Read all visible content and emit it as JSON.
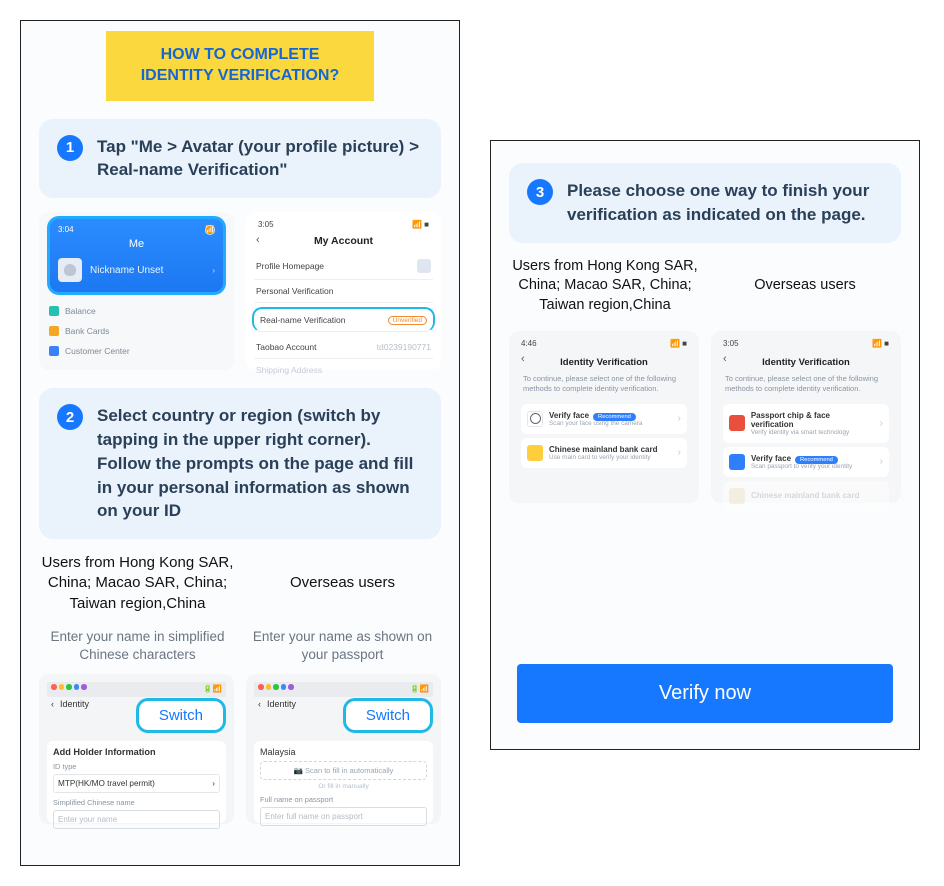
{
  "banner": {
    "line1": "HOW TO COMPLETE",
    "line2": "IDENTITY VERIFICATION?"
  },
  "steps": {
    "1": {
      "num": "1",
      "text": "Tap \"Me > Avatar (your profile picture) > Real-name Verification\""
    },
    "2": {
      "num": "2",
      "text": "Select country or region (switch by tapping in the upper right corner). Follow the prompts on the page and fill in your personal information as shown on your ID"
    },
    "3": {
      "num": "3",
      "text": "Please choose one way to finish your verification as indicated on the page."
    }
  },
  "phone_me": {
    "time": "3:04",
    "title": "Me",
    "nickname": "Nickname Unset",
    "rows": {
      "balance": "Balance",
      "bank": "Bank Cards",
      "center": "Customer Center"
    }
  },
  "phone_account": {
    "time": "3:05",
    "title": "My Account",
    "rows": {
      "profile": "Profile Homepage",
      "personal": "Personal Verification",
      "realname": "Real-name Verification",
      "badge": "Unverified",
      "taobao": "Taobao Account",
      "taobao_val": "td0239190771",
      "ship": "Shipping Address"
    }
  },
  "cols_left": {
    "c1_head": "Users from Hong Kong SAR, China; Macao SAR, China; Taiwan region,China",
    "c2_head": "Overseas users",
    "c1_sub": "Enter your name in simplified Chinese characters",
    "c2_sub": "Enter your name as shown on your passport"
  },
  "switch_label": "Switch",
  "form_left": {
    "header": "Identity",
    "section": "Add Holder Information",
    "id_type_label": "ID type",
    "id_type_value": "MTP(HK/MO travel permit)",
    "name_label": "Simplified Chinese name",
    "name_ph": "Enter your name"
  },
  "form_right": {
    "header": "Identity",
    "country": "Malaysia",
    "scan": "Scan to fill in automatically",
    "or": "Or fill in manually",
    "name_label": "Full name on passport",
    "name_ph": "Enter full name on passport"
  },
  "cols_right": {
    "c1_head": "Users from Hong Kong SAR, China; Macao SAR, China; Taiwan region,China",
    "c2_head": "Overseas users"
  },
  "verify_left": {
    "time": "4:46",
    "title": "Identity Verification",
    "sub": "To continue, please select one of the following methods to complete identity verification.",
    "opt1_t": "Verify face",
    "opt1_s": "Scan your face using the camera",
    "opt1_badge": "Recommend",
    "opt2_t": "Chinese mainland bank card",
    "opt2_s": "Use main card to verify your identity"
  },
  "verify_right": {
    "time": "3:05",
    "title": "Identity Verification",
    "sub": "To continue, please select one of the following methods to complete identity verification.",
    "opt1_t": "Passport chip & face verification",
    "opt1_s": "Verify identity via smart technology",
    "opt2_t": "Verify face",
    "opt2_s": "Scan passport to verify your identity",
    "opt2_badge": "Recommend",
    "opt3_t": "Chinese mainland bank card"
  },
  "verify_btn": "Verify now"
}
